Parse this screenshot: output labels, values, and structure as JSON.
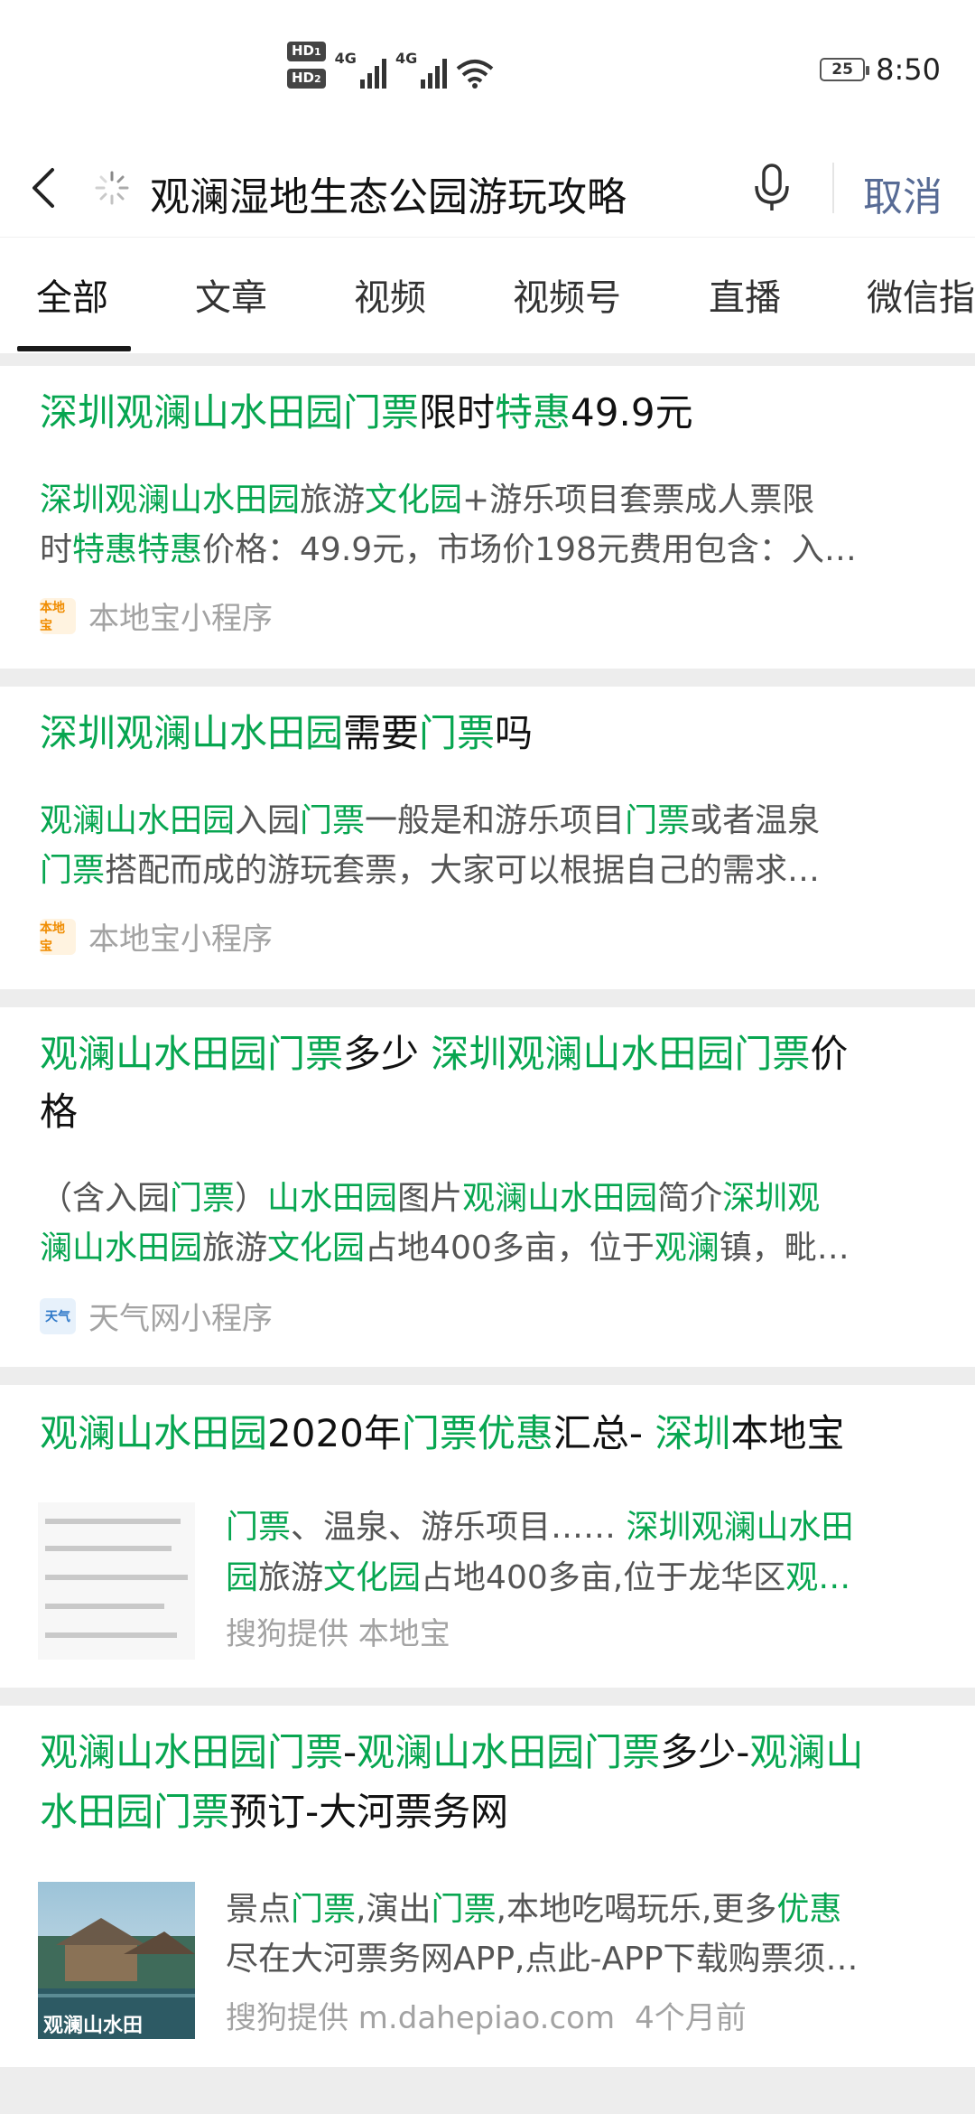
{
  "status_bar": {
    "hd1": "HD",
    "hd1_sub": "1",
    "hd2": "HD",
    "hd2_sub": "2",
    "net1": "4G",
    "net2": "4G",
    "battery": "25",
    "time": "8:50"
  },
  "search": {
    "query": "观澜湿地生态公园游玩攻略",
    "cancel_label": "取消"
  },
  "tabs": [
    {
      "label": "全部",
      "active": true
    },
    {
      "label": "文章",
      "active": false
    },
    {
      "label": "视频",
      "active": false
    },
    {
      "label": "视频号",
      "active": false
    },
    {
      "label": "直播",
      "active": false
    },
    {
      "label": "微信指",
      "active": false
    }
  ],
  "results": [
    {
      "title_parts": [
        {
          "t": "深圳观澜山水田园门票",
          "hl": true
        },
        {
          "t": "限时",
          "hl": false
        },
        {
          "t": "特惠",
          "hl": true
        },
        {
          "t": "49.9元",
          "hl": false
        }
      ],
      "snippet_line1": [
        {
          "t": "深圳观澜山水田园",
          "hl": true
        },
        {
          "t": "旅游",
          "hl": false
        },
        {
          "t": "文化园",
          "hl": true
        },
        {
          "t": "+游乐项目套票成人票限",
          "hl": false
        }
      ],
      "snippet_line2": [
        {
          "t": "时",
          "hl": false
        },
        {
          "t": "特惠特惠",
          "hl": true
        },
        {
          "t": "价格：49.9元，市场价198元费用包含：入…",
          "hl": false
        }
      ],
      "source": "本地宝小程序",
      "logo_text": "本地宝"
    },
    {
      "title_parts": [
        {
          "t": "深圳观澜山水田园",
          "hl": true
        },
        {
          "t": "需要",
          "hl": false
        },
        {
          "t": "门票",
          "hl": true
        },
        {
          "t": "吗",
          "hl": false
        }
      ],
      "snippet_line1": [
        {
          "t": "观澜山水田园",
          "hl": true
        },
        {
          "t": "入园",
          "hl": false
        },
        {
          "t": "门票",
          "hl": true
        },
        {
          "t": "一般是和游乐项目",
          "hl": false
        },
        {
          "t": "门票",
          "hl": true
        },
        {
          "t": "或者温泉",
          "hl": false
        }
      ],
      "snippet_line2": [
        {
          "t": "门票",
          "hl": true
        },
        {
          "t": "搭配而成的游玩套票，大家可以根据自己的需求…",
          "hl": false
        }
      ],
      "source": "本地宝小程序",
      "logo_text": "本地宝"
    },
    {
      "title_line1": [
        {
          "t": "观澜山水田园门票",
          "hl": true
        },
        {
          "t": "多少 ",
          "hl": false
        },
        {
          "t": "深圳观澜山水田园门票",
          "hl": true
        },
        {
          "t": "价",
          "hl": false
        }
      ],
      "title_line2": [
        {
          "t": "格",
          "hl": false
        }
      ],
      "snippet_line1": [
        {
          "t": "（含入园",
          "hl": false
        },
        {
          "t": "门票",
          "hl": true
        },
        {
          "t": "）",
          "hl": false
        },
        {
          "t": "山水田园",
          "hl": true
        },
        {
          "t": "图片",
          "hl": false
        },
        {
          "t": "观澜山水田园",
          "hl": true
        },
        {
          "t": "简介",
          "hl": false
        },
        {
          "t": "深圳观",
          "hl": true
        }
      ],
      "snippet_line2": [
        {
          "t": "澜山水田园",
          "hl": true
        },
        {
          "t": "旅游",
          "hl": false
        },
        {
          "t": "文化园",
          "hl": true
        },
        {
          "t": "占地400多亩，位于",
          "hl": false
        },
        {
          "t": "观澜",
          "hl": true
        },
        {
          "t": "镇，毗…",
          "hl": false
        }
      ],
      "source": "天气网小程序",
      "logo_text": "天气"
    },
    {
      "title_parts": [
        {
          "t": "观澜山水田园",
          "hl": true
        },
        {
          "t": "2020年",
          "hl": false
        },
        {
          "t": "门票优惠",
          "hl": true
        },
        {
          "t": "汇总- ",
          "hl": false
        },
        {
          "t": "深圳",
          "hl": true
        },
        {
          "t": "本地宝",
          "hl": false
        }
      ],
      "snippet_line1": [
        {
          "t": "门票",
          "hl": true
        },
        {
          "t": "、温泉、游乐项目…… ",
          "hl": false
        },
        {
          "t": "深圳观澜山水田",
          "hl": true
        }
      ],
      "snippet_line2": [
        {
          "t": "园",
          "hl": true
        },
        {
          "t": "旅游",
          "hl": false
        },
        {
          "t": "文化园",
          "hl": true
        },
        {
          "t": "占地400多亩,位于龙华区",
          "hl": false
        },
        {
          "t": "观…",
          "hl": true
        }
      ],
      "source": "搜狗提供 本地宝"
    },
    {
      "title_line1": [
        {
          "t": "观澜山水田园门票",
          "hl": true
        },
        {
          "t": "-",
          "hl": false
        },
        {
          "t": "观澜山水田园门票",
          "hl": true
        },
        {
          "t": "多少-",
          "hl": false
        },
        {
          "t": "观澜山",
          "hl": true
        }
      ],
      "title_line2": [
        {
          "t": "水田园门票",
          "hl": true
        },
        {
          "t": "预订-大河票务网",
          "hl": false
        }
      ],
      "snippet_line1": [
        {
          "t": "景点",
          "hl": false
        },
        {
          "t": "门票",
          "hl": true
        },
        {
          "t": ",演出",
          "hl": false
        },
        {
          "t": "门票",
          "hl": true
        },
        {
          "t": ",本地吃喝玩乐,更多",
          "hl": false
        },
        {
          "t": "优惠",
          "hl": true
        }
      ],
      "snippet_line2": [
        {
          "t": "尽在大河票务网APP,点此-APP下载购票须…",
          "hl": false
        }
      ],
      "source": "搜狗提供 m.dahepiao.com",
      "time": "4个月前",
      "thumb_caption": "观澜山水田"
    }
  ]
}
